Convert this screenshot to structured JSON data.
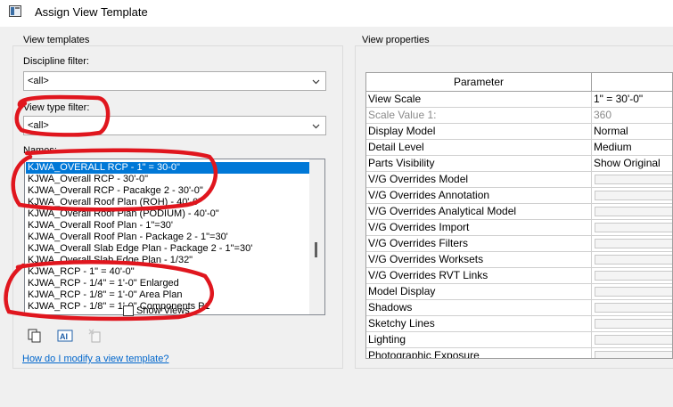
{
  "window": {
    "title": "Assign View Template"
  },
  "view_templates": {
    "group_label": "View templates",
    "discipline_filter_label": "Discipline filter:",
    "discipline_filter_value": "<all>",
    "view_type_filter_label": "View type filter:",
    "view_type_filter_value": "<all>",
    "names_label": "Names:",
    "names": [
      "KJWA_OVERALL RCP - 1\" = 30-0\"",
      "KJWA_Overall RCP - 30'-0\"",
      "KJWA_Overall RCP - Pacakge 2 - 30'-0\"",
      "KJWA_Overall Roof Plan (ROH) - 40'-0\"",
      "KJWA_Overall Roof Plan (PODIUM) - 40'-0\"",
      "KJWA_Overall Roof Plan - 1\"=30'",
      "KJWA_Overall Roof Plan - Package 2 - 1\"=30'",
      "KJWA_Overall Slab Edge Plan - Package 2 - 1\"=30'",
      "KJWA_Overall Slab Edge Plan - 1/32\"",
      "KJWA_RCP - 1\" = 40'-0\"",
      "KJWA_RCP - 1/4\" = 1'-0\" Enlarged",
      "KJWA_RCP - 1/8\" = 1'-0\" Area Plan",
      "KJWA_RCP - 1/8\" = 1'-0\" Components P1"
    ],
    "selected_index": 0,
    "show_views_label": "Show Views",
    "show_views_checked": false
  },
  "view_properties": {
    "group_label": "View properties",
    "header_parameter": "Parameter",
    "header_value": "",
    "rows": [
      {
        "param": "View Scale",
        "value": "1\" = 30'-0\"",
        "disabled": false,
        "button": false
      },
      {
        "param": "Scale Value    1:",
        "value": "360",
        "disabled": true,
        "button": false
      },
      {
        "param": "Display Model",
        "value": "Normal",
        "disabled": false,
        "button": false
      },
      {
        "param": "Detail Level",
        "value": "Medium",
        "disabled": false,
        "button": false
      },
      {
        "param": "Parts Visibility",
        "value": "Show Original",
        "disabled": false,
        "button": false
      },
      {
        "param": "V/G Overrides Model",
        "value": "",
        "disabled": false,
        "button": true
      },
      {
        "param": "V/G Overrides Annotation",
        "value": "",
        "disabled": false,
        "button": true
      },
      {
        "param": "V/G Overrides Analytical Model",
        "value": "",
        "disabled": false,
        "button": true
      },
      {
        "param": "V/G Overrides Import",
        "value": "",
        "disabled": false,
        "button": true
      },
      {
        "param": "V/G Overrides Filters",
        "value": "",
        "disabled": false,
        "button": true
      },
      {
        "param": "V/G Overrides Worksets",
        "value": "",
        "disabled": false,
        "button": true
      },
      {
        "param": "V/G Overrides RVT Links",
        "value": "",
        "disabled": false,
        "button": true
      },
      {
        "param": "Model Display",
        "value": "",
        "disabled": false,
        "button": true
      },
      {
        "param": "Shadows",
        "value": "",
        "disabled": false,
        "button": true
      },
      {
        "param": "Sketchy Lines",
        "value": "",
        "disabled": false,
        "button": true
      },
      {
        "param": "Lighting",
        "value": "",
        "disabled": false,
        "button": true
      },
      {
        "param": "Photographic Exposure",
        "value": "",
        "disabled": false,
        "button": true
      }
    ]
  },
  "help_link": "How do I modify a view template?",
  "icons": [
    "window-icon",
    "duplicate-icon",
    "rename-icon",
    "delete-icon",
    "chevron-down-icon"
  ],
  "colors": {
    "selection": "#0078d7",
    "annotation": "#e0161e",
    "link": "#0066cc"
  }
}
